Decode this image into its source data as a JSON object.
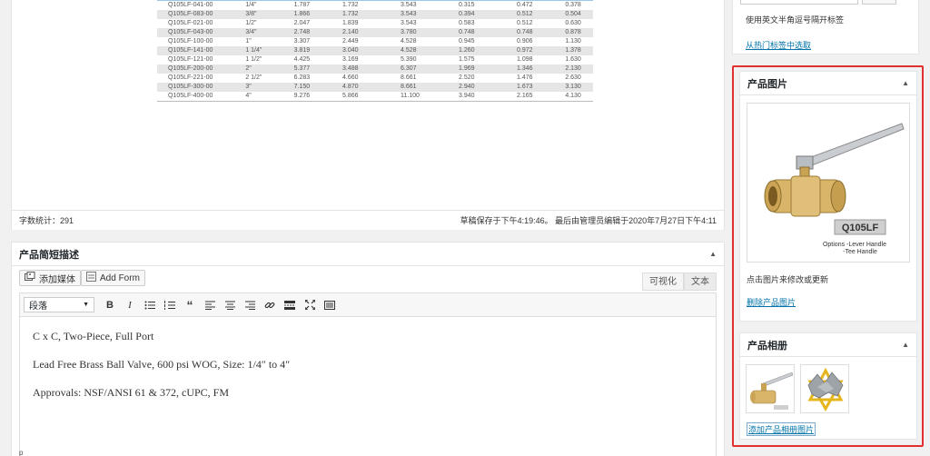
{
  "spec_table": {
    "rows": [
      [
        "Q105LF-041-00",
        "1/4\"",
        "1.787",
        "1.732",
        "3.543",
        "0.315",
        "0.472",
        "0.378"
      ],
      [
        "Q105LF-083-00",
        "3/8\"",
        "1.866",
        "1.732",
        "3.543",
        "0.394",
        "0.512",
        "0.504"
      ],
      [
        "Q105LF-021-00",
        "1/2\"",
        "2.047",
        "1.839",
        "3.543",
        "0.583",
        "0.512",
        "0.630"
      ],
      [
        "Q105LF-043-00",
        "3/4\"",
        "2.748",
        "2.140",
        "3.780",
        "0.748",
        "0.748",
        "0.878"
      ],
      [
        "Q105LF-100-00",
        "1\"",
        "3.307",
        "2.449",
        "4.528",
        "0.945",
        "0.906",
        "1.130"
      ],
      [
        "Q105LF-141-00",
        "1 1/4\"",
        "3.819",
        "3.040",
        "4.528",
        "1.260",
        "0.972",
        "1.378"
      ],
      [
        "Q105LF-121-00",
        "1 1/2\"",
        "4.425",
        "3.169",
        "5.390",
        "1.575",
        "1.098",
        "1.630"
      ],
      [
        "Q105LF-200-00",
        "2\"",
        "5.377",
        "3.488",
        "6.307",
        "1.969",
        "1.346",
        "2.130"
      ],
      [
        "Q105LF-221-00",
        "2 1/2\"",
        "6.283",
        "4.660",
        "8.661",
        "2.520",
        "1.476",
        "2.630"
      ],
      [
        "Q105LF-300-00",
        "3\"",
        "7.150",
        "4.870",
        "8.661",
        "2.940",
        "1.673",
        "3.130"
      ],
      [
        "Q105LF-400-00",
        "4\"",
        "9.276",
        "5.866",
        "11.100",
        "3.940",
        "2.165",
        "4.130"
      ]
    ]
  },
  "status_bar": {
    "word_count": "字数统计：291",
    "saved_info": "草稿保存于下午4:19:46。 最后由管理员编辑于2020年7月27日下午4:11"
  },
  "excerpt": {
    "title": "产品简短描述",
    "add_media": "添加媒体",
    "add_form": "Add Form",
    "tab_visual": "可视化",
    "tab_text": "文本",
    "format_select": "段落",
    "paragraphs": [
      "C x C, Two-Piece, Full Port",
      "Lead Free Brass Ball Valve, 600 psi WOG, Size: 1/4″ to 4″",
      "Approvals: NSF/ANSI 61 & 372, cUPC, FM"
    ],
    "path": "p"
  },
  "tags": {
    "help": "使用英文半角逗号隔开标签",
    "popular_link": "从热门标签中选取"
  },
  "product_image": {
    "title": "产品图片",
    "model_label": "Q105LF",
    "options_line1": "Options -Lever Handle",
    "options_line2": "-Tee Handle",
    "hint": "点击图片来修改或更新",
    "remove_link": "删除产品图片"
  },
  "gallery": {
    "title": "产品相册",
    "add_link": "添加产品相册图片"
  },
  "colors": {
    "highlight_frame": "#e0302f",
    "link": "#0073aa"
  }
}
